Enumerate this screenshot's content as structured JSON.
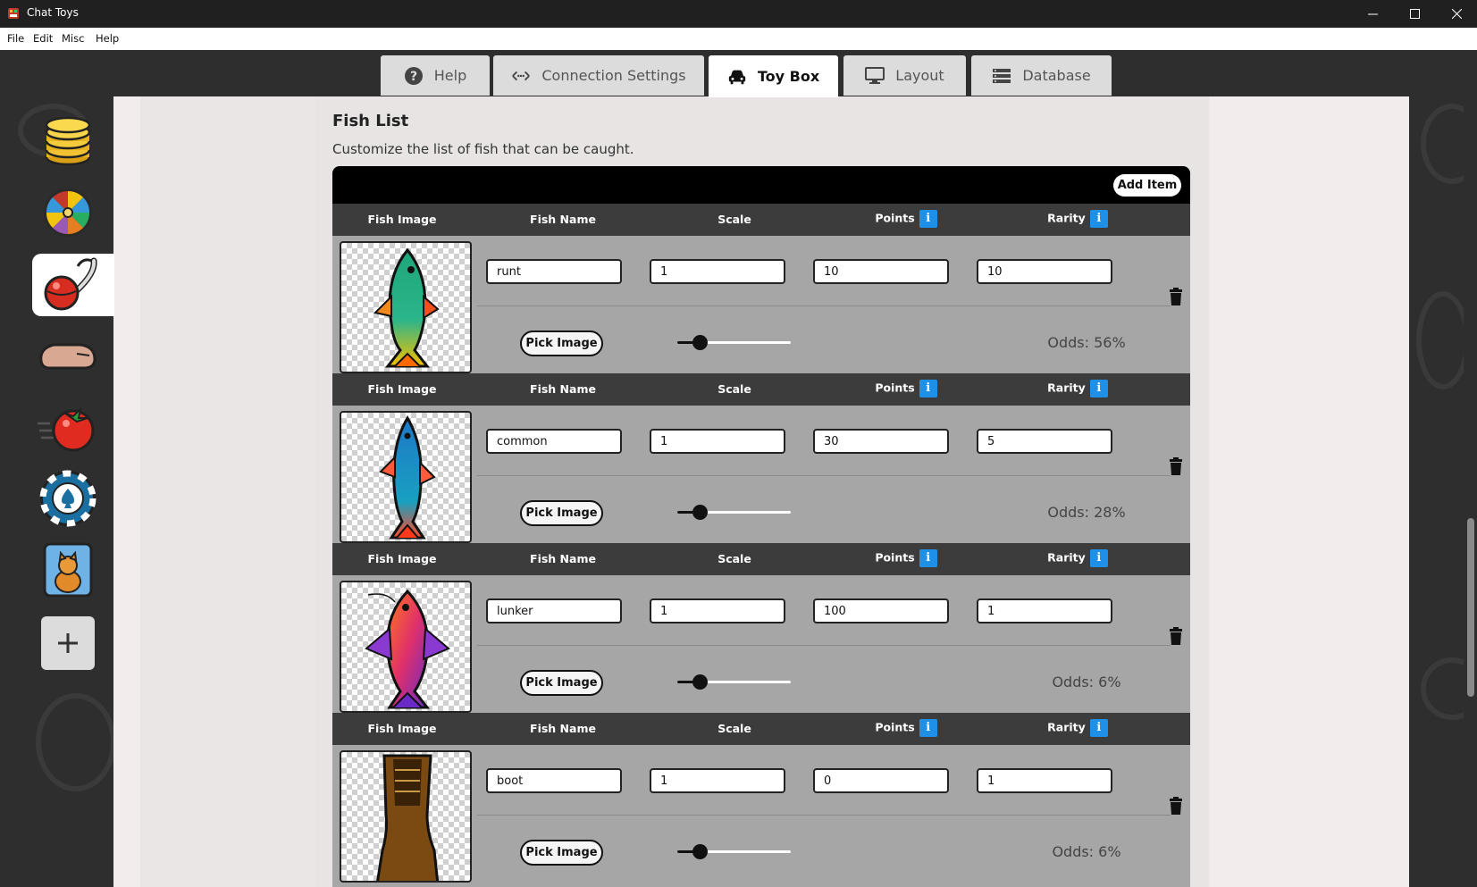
{
  "window": {
    "title": "Chat Toys"
  },
  "menu": [
    "File",
    "Edit",
    "Misc",
    "Help"
  ],
  "tabs": [
    {
      "label": "Help",
      "icon": "question-circle-icon"
    },
    {
      "label": "Connection Settings",
      "icon": "connection-arrows-icon"
    },
    {
      "label": "Toy Box",
      "icon": "car-icon",
      "active": true
    },
    {
      "label": "Layout",
      "icon": "monitor-icon"
    },
    {
      "label": "Database",
      "icon": "database-icon"
    }
  ],
  "sidebar": [
    {
      "name": "coins",
      "icon": "coin-stack-icon"
    },
    {
      "name": "wheel",
      "icon": "prize-wheel-icon"
    },
    {
      "name": "fishing",
      "icon": "fishing-bobber-icon",
      "active": true
    },
    {
      "name": "hand",
      "icon": "hand-icon"
    },
    {
      "name": "tomato",
      "icon": "tomato-icon"
    },
    {
      "name": "poker-chip",
      "icon": "poker-chip-icon"
    },
    {
      "name": "cat",
      "icon": "cat-card-icon"
    },
    {
      "name": "add",
      "icon": "plus-icon"
    }
  ],
  "section": {
    "title": "Fish List",
    "description": "Customize the list of fish that can be caught."
  },
  "table": {
    "add_label": "Add Item",
    "headers": {
      "image": "Fish Image",
      "name": "Fish Name",
      "scale": "Scale",
      "points": "Points",
      "rarity": "Rarity",
      "info": "i"
    },
    "pick_label": "Pick Image",
    "rows": [
      {
        "name": "runt",
        "scale": "1",
        "points": "10",
        "rarity": "10",
        "odds": "Odds: 56%",
        "slider": 0.2
      },
      {
        "name": "common",
        "scale": "1",
        "points": "30",
        "rarity": "5",
        "odds": "Odds: 28%",
        "slider": 0.2
      },
      {
        "name": "lunker",
        "scale": "1",
        "points": "100",
        "rarity": "1",
        "odds": "Odds: 6%",
        "slider": 0.2
      },
      {
        "name": "boot",
        "scale": "1",
        "points": "0",
        "rarity": "1",
        "odds": "Odds: 6%",
        "slider": 0.2
      }
    ]
  },
  "colors": {
    "row_bg": "#a6a6a6",
    "header_bg": "#3c3c3c",
    "info_blue": "#1e90e8"
  }
}
